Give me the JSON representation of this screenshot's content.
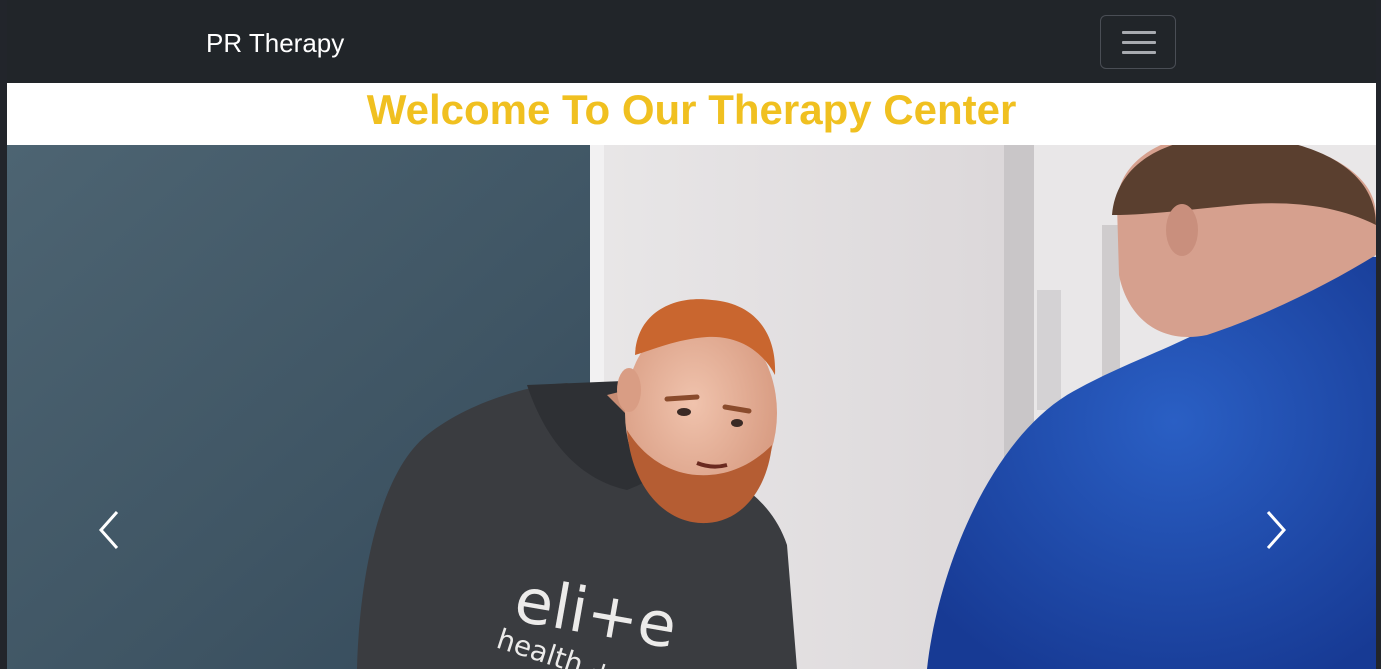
{
  "navbar": {
    "brand": "PR Therapy",
    "toggler_icon": "hamburger-menu-icon",
    "background": "#212529"
  },
  "hero": {
    "title": "Welcome To Our Therapy Center",
    "title_color": "#f0c020"
  },
  "carousel": {
    "prev_icon": "chevron-left-icon",
    "next_icon": "chevron-right-icon",
    "slide_image": "therapist-with-client-photo",
    "hoodie_text_line1": "eli+e",
    "hoodie_text_line2": "health +"
  }
}
